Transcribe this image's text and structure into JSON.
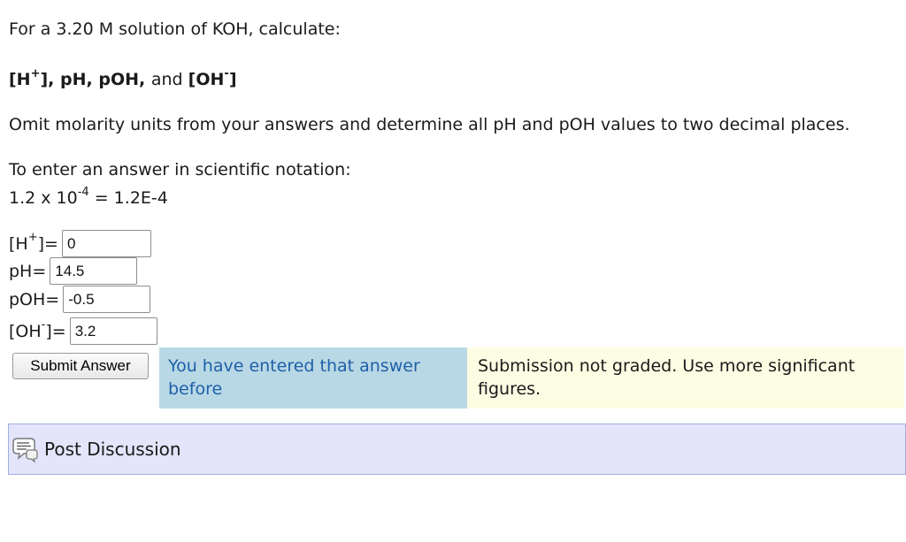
{
  "intro": {
    "text": "For a 3.20 M solution of KOH, calculate:"
  },
  "targets": {
    "h_base": "[H",
    "h_sup": "+",
    "h_close": "], ",
    "ph": "pH, ",
    "poh": "pOH, ",
    "and": "and ",
    "oh_base": "[OH",
    "oh_sup": "-",
    "oh_close": "]"
  },
  "instructions": {
    "omit_units": "Omit molarity units from your answers and determine all pH and pOH values to two decimal places.",
    "sci_notation_heading": "To enter an answer in scientific notation:",
    "example_base": "1.2 x 10",
    "example_exp": "-4",
    "example_result": " = 1.2E-4"
  },
  "fields": {
    "h": {
      "label_base": "[H",
      "label_sup": "+",
      "label_close": "]=",
      "value": "0"
    },
    "ph": {
      "label": "pH=",
      "value": "14.5"
    },
    "poh": {
      "label": "pOH=",
      "value": "-0.5"
    },
    "oh": {
      "label_base": "[OH",
      "label_sup": "-",
      "label_close": "]=",
      "value": "3.2"
    }
  },
  "submit": {
    "label": "Submit Answer"
  },
  "feedback": {
    "repeat_message": "You have entered that answer before",
    "grade_message": "Submission not graded. Use more significant figures.",
    "repeat_color": "#b8d8e5",
    "grade_color": "#fdfde4"
  },
  "discussion": {
    "label": "Post Discussion",
    "icon": "discussion-bubble-icon"
  }
}
